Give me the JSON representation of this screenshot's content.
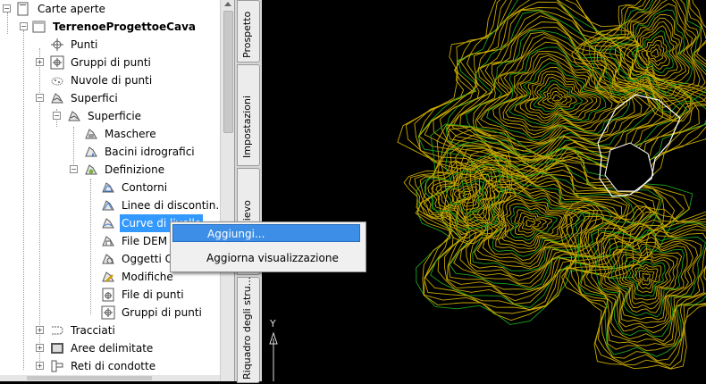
{
  "tree": {
    "items": [
      {
        "label": "Carte aperte",
        "icon": "open-drawings-icon"
      },
      {
        "label": "TerrenoeProgettoeCava",
        "icon": "drawing-icon"
      },
      {
        "label": "Punti",
        "icon": "points-icon"
      },
      {
        "label": "Gruppi di punti",
        "icon": "point-groups-icon"
      },
      {
        "label": "Nuvole di punti",
        "icon": "point-clouds-icon"
      },
      {
        "label": "Superfici",
        "icon": "surfaces-icon"
      },
      {
        "label": "Superficie",
        "icon": "surface-icon"
      },
      {
        "label": "Maschere",
        "icon": "masks-icon"
      },
      {
        "label": "Bacini idrografici",
        "icon": "watersheds-icon"
      },
      {
        "label": "Definizione",
        "icon": "definition-icon"
      },
      {
        "label": "Contorni",
        "icon": "boundaries-icon"
      },
      {
        "label": "Linee di discontin...",
        "icon": "breaklines-icon"
      },
      {
        "label": "Curve di livello",
        "icon": "contours-icon"
      },
      {
        "label": "File DEM",
        "icon": "dem-files-icon"
      },
      {
        "label": "Oggetti Ca",
        "icon": "drawing-objects-icon"
      },
      {
        "label": "Modifiche",
        "icon": "edits-icon"
      },
      {
        "label": "File di punti",
        "icon": "point-files-icon"
      },
      {
        "label": "Gruppi di punti",
        "icon": "point-groups-icon"
      },
      {
        "label": "Tracciati",
        "icon": "alignments-icon"
      },
      {
        "label": "Aree delimitate",
        "icon": "sites-icon"
      },
      {
        "label": "Reti di condotte",
        "icon": "pipe-networks-icon"
      }
    ]
  },
  "tabs": {
    "prospetto": "Prospetto",
    "impostazioni": "Impostazioni",
    "rilievo": "Rilievo",
    "riquadro": "Riquadro degli stru..."
  },
  "context_menu": {
    "add": "Aggiungi...",
    "refresh": "Aggiorna visualizzazione"
  },
  "canvas": {
    "ucs_y": "Y",
    "colors": {
      "contour_major": "#1fa31f",
      "contour_minor": "#c8a800",
      "boundary": "#ffffff"
    }
  }
}
